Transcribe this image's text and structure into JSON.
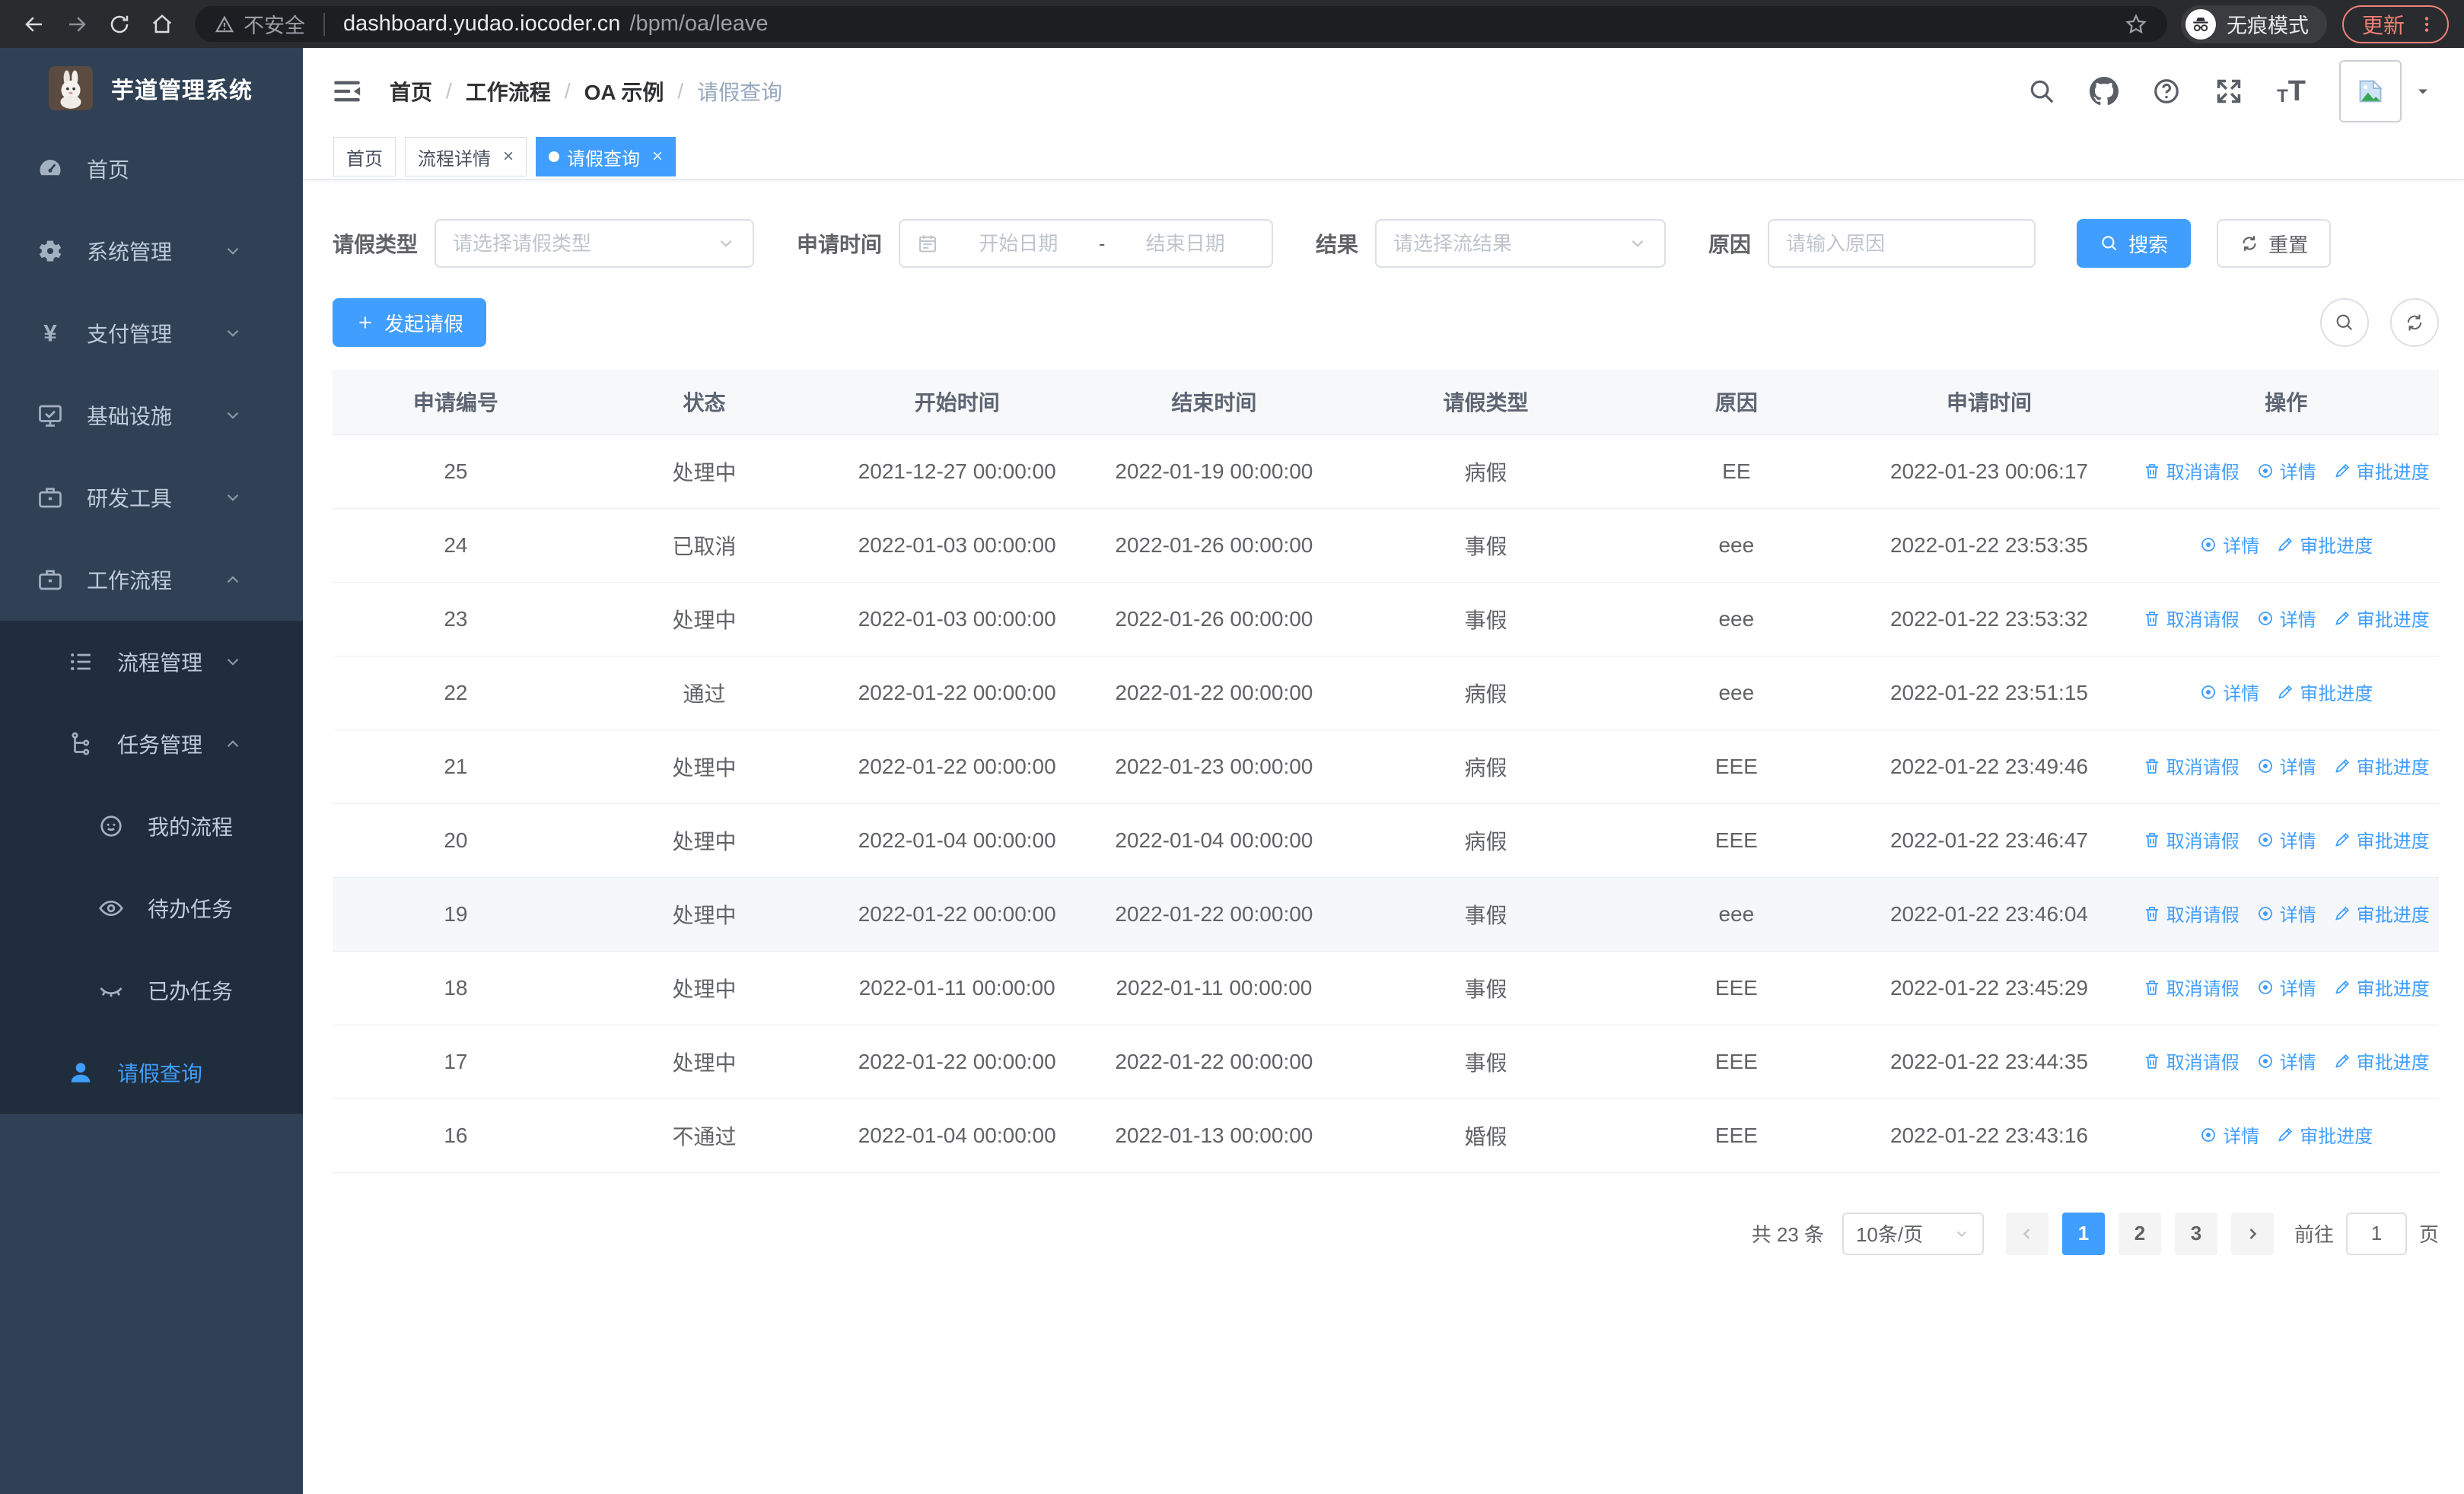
{
  "accent": "#409eff",
  "browser": {
    "security_label": "不安全",
    "url_host": "dashboard.yudao.iocoder.cn",
    "url_path": "/bpm/oa/leave",
    "incognito_label": "无痕模式",
    "update_label": "更新"
  },
  "sidebar": {
    "title": "芋道管理系统",
    "items": [
      {
        "label": "首页",
        "icon": "dashboard-icon",
        "level": 0,
        "sub": false,
        "chevron": null,
        "active": false
      },
      {
        "label": "系统管理",
        "icon": "gear-icon",
        "level": 0,
        "sub": false,
        "chevron": "down",
        "active": false
      },
      {
        "label": "支付管理",
        "icon": "yen-icon",
        "level": 0,
        "sub": false,
        "chevron": "down",
        "active": false
      },
      {
        "label": "基础设施",
        "icon": "monitor-icon",
        "level": 0,
        "sub": false,
        "chevron": "down",
        "active": false
      },
      {
        "label": "研发工具",
        "icon": "toolbox-icon",
        "level": 0,
        "sub": false,
        "chevron": "down",
        "active": false
      },
      {
        "label": "工作流程",
        "icon": "briefcase-icon",
        "level": 0,
        "sub": false,
        "chevron": "up",
        "active": false
      },
      {
        "label": "流程管理",
        "icon": "list-icon",
        "level": 1,
        "sub": true,
        "chevron": "down",
        "active": false
      },
      {
        "label": "任务管理",
        "icon": "tree-icon",
        "level": 1,
        "sub": true,
        "chevron": "up",
        "active": false
      },
      {
        "label": "我的流程",
        "icon": "person-icon",
        "level": 2,
        "sub": true,
        "chevron": null,
        "active": false
      },
      {
        "label": "待办任务",
        "icon": "eye-open-icon",
        "level": 2,
        "sub": true,
        "chevron": null,
        "active": false
      },
      {
        "label": "已办任务",
        "icon": "eye-closed-icon",
        "level": 2,
        "sub": true,
        "chevron": null,
        "active": false
      },
      {
        "label": "请假查询",
        "icon": "user-icon",
        "level": 1,
        "sub": true,
        "chevron": null,
        "active": true
      }
    ]
  },
  "breadcrumb": {
    "items": [
      "首页",
      "工作流程",
      "OA 示例",
      "请假查询"
    ]
  },
  "tags": [
    {
      "label": "首页",
      "closable": false,
      "active": false
    },
    {
      "label": "流程详情",
      "closable": true,
      "active": false
    },
    {
      "label": "请假查询",
      "closable": true,
      "active": true
    }
  ],
  "filters": {
    "leave_type": {
      "label": "请假类型",
      "placeholder": "请选择请假类型"
    },
    "apply_time": {
      "label": "申请时间",
      "start_placeholder": "开始日期",
      "separator": "-",
      "end_placeholder": "结束日期"
    },
    "result": {
      "label": "结果",
      "placeholder": "请选择流结果"
    },
    "reason": {
      "label": "原因",
      "placeholder": "请输入原因"
    },
    "search_label": "搜索",
    "reset_label": "重置"
  },
  "toolbar": {
    "create_label": "发起请假"
  },
  "table": {
    "columns": [
      "申请编号",
      "状态",
      "开始时间",
      "结束时间",
      "请假类型",
      "原因",
      "申请时间",
      "操作"
    ],
    "action_labels": {
      "cancel": "取消请假",
      "detail": "详情",
      "progress": "审批进度"
    },
    "rows": [
      {
        "id": "25",
        "status": "处理中",
        "start": "2021-12-27 00:00:00",
        "end": "2022-01-19 00:00:00",
        "type": "病假",
        "reason": "EE",
        "apply_time": "2022-01-23 00:06:17",
        "actions": [
          "cancel",
          "detail",
          "progress"
        ],
        "highlight": false
      },
      {
        "id": "24",
        "status": "已取消",
        "start": "2022-01-03 00:00:00",
        "end": "2022-01-26 00:00:00",
        "type": "事假",
        "reason": "eee",
        "apply_time": "2022-01-22 23:53:35",
        "actions": [
          "detail",
          "progress"
        ],
        "highlight": false
      },
      {
        "id": "23",
        "status": "处理中",
        "start": "2022-01-03 00:00:00",
        "end": "2022-01-26 00:00:00",
        "type": "事假",
        "reason": "eee",
        "apply_time": "2022-01-22 23:53:32",
        "actions": [
          "cancel",
          "detail",
          "progress"
        ],
        "highlight": false
      },
      {
        "id": "22",
        "status": "通过",
        "start": "2022-01-22 00:00:00",
        "end": "2022-01-22 00:00:00",
        "type": "病假",
        "reason": "eee",
        "apply_time": "2022-01-22 23:51:15",
        "actions": [
          "detail",
          "progress"
        ],
        "highlight": false
      },
      {
        "id": "21",
        "status": "处理中",
        "start": "2022-01-22 00:00:00",
        "end": "2022-01-23 00:00:00",
        "type": "病假",
        "reason": "EEE",
        "apply_time": "2022-01-22 23:49:46",
        "actions": [
          "cancel",
          "detail",
          "progress"
        ],
        "highlight": false
      },
      {
        "id": "20",
        "status": "处理中",
        "start": "2022-01-04 00:00:00",
        "end": "2022-01-04 00:00:00",
        "type": "病假",
        "reason": "EEE",
        "apply_time": "2022-01-22 23:46:47",
        "actions": [
          "cancel",
          "detail",
          "progress"
        ],
        "highlight": false
      },
      {
        "id": "19",
        "status": "处理中",
        "start": "2022-01-22 00:00:00",
        "end": "2022-01-22 00:00:00",
        "type": "事假",
        "reason": "eee",
        "apply_time": "2022-01-22 23:46:04",
        "actions": [
          "cancel",
          "detail",
          "progress"
        ],
        "highlight": true
      },
      {
        "id": "18",
        "status": "处理中",
        "start": "2022-01-11 00:00:00",
        "end": "2022-01-11 00:00:00",
        "type": "事假",
        "reason": "EEE",
        "apply_time": "2022-01-22 23:45:29",
        "actions": [
          "cancel",
          "detail",
          "progress"
        ],
        "highlight": false
      },
      {
        "id": "17",
        "status": "处理中",
        "start": "2022-01-22 00:00:00",
        "end": "2022-01-22 00:00:00",
        "type": "事假",
        "reason": "EEE",
        "apply_time": "2022-01-22 23:44:35",
        "actions": [
          "cancel",
          "detail",
          "progress"
        ],
        "highlight": false
      },
      {
        "id": "16",
        "status": "不通过",
        "start": "2022-01-04 00:00:00",
        "end": "2022-01-13 00:00:00",
        "type": "婚假",
        "reason": "EEE",
        "apply_time": "2022-01-22 23:43:16",
        "actions": [
          "detail",
          "progress"
        ],
        "highlight": false
      }
    ]
  },
  "pagination": {
    "total_label": "共 23 条",
    "page_size_label": "10条/页",
    "pages": [
      "1",
      "2",
      "3"
    ],
    "active_page": "1",
    "goto_label": "前往",
    "goto_value": "1",
    "goto_unit": "页"
  }
}
